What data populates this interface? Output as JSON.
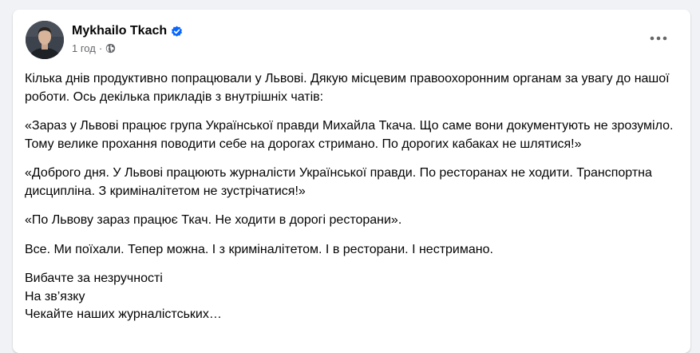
{
  "post": {
    "author": {
      "name": "Mykhailo Tkach",
      "verified": true,
      "avatar_icon": "profile-photo"
    },
    "meta": {
      "time": "1 год",
      "separator": "·",
      "audience_icon": "globe-icon"
    },
    "more_options_icon": "more-horizontal-icon",
    "paragraphs": [
      "Кілька днів продуктивно попрацювали у Львові. Дякую місцевим правоохоронним органам за увагу до нашої роботи. Ось декілька прикладів з внутрішніх чатів:",
      "«Зараз у Львові працює група Української правди Михайла Ткача. Що саме вони документують не зрозуміло. Тому велике прохання поводити себе на дорогах стримано. По дорогих кабаках не шлятися!»",
      "«Доброго дня. У Львові працюють журналісти Української правди. По ресторанах не ходити. Транспортна дисципліна. З криміналітетом не зустрічатися!»",
      "«По Львову зараз працює Ткач. Не ходити в дорогі ресторани».",
      "Все. Ми поїхали. Тепер можна. І з криміналітетом. І в ресторани. І нестримано."
    ],
    "closing_lines": [
      "Вибачте за незручності",
      "На зв’язку",
      "Чекайте наших журналістських…"
    ]
  },
  "colors": {
    "page_bg": "#f0f2f5",
    "card_bg": "#ffffff",
    "text_primary": "#050505",
    "text_secondary": "#65676b",
    "verified_blue": "#0866ff"
  }
}
